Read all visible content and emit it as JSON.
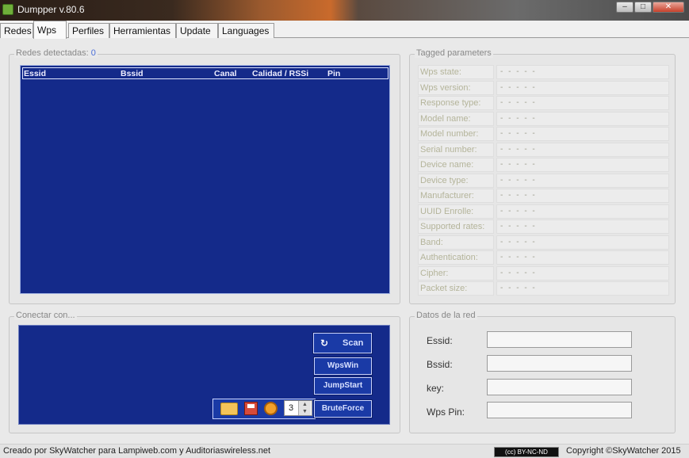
{
  "window": {
    "title": "Dumpper v.80.6",
    "minimize": "–",
    "maximize": "□",
    "close": "✕"
  },
  "tabs": [
    "Redes",
    "Wps",
    "Perfiles",
    "Herramientas",
    "Update",
    "Languages"
  ],
  "active_tab": "Wps",
  "networks": {
    "title": "Redes detectadas:",
    "count": "0",
    "columns": [
      "Essid",
      "Bssid",
      "Canal",
      "Calidad / RSSi",
      "Pin"
    ],
    "rows": []
  },
  "tagged": {
    "title": "Tagged parameters",
    "placeholder": "- - - - -",
    "labels": [
      "Wps state:",
      "Wps version:",
      "Response type:",
      "Model name:",
      "Model number:",
      "Serial number:",
      "Device name:",
      "Device type:",
      "Manufacturer:",
      "UUID Enrolle:",
      "Supported rates:",
      "Band:",
      "Authentication:",
      "Cipher:",
      "Packet size:"
    ]
  },
  "connect": {
    "title": "Conectar con...",
    "scan": "Scan",
    "wpswin": "WpsWin",
    "jumpstart": "JumpStart",
    "bruteforce": "BruteForce",
    "stepper_value": "3"
  },
  "datos": {
    "title": "Datos de la red",
    "fields": [
      {
        "label": "Essid:",
        "value": ""
      },
      {
        "label": "Bssid:",
        "value": ""
      },
      {
        "label": "key:",
        "value": ""
      },
      {
        "label": "Wps Pin:",
        "value": ""
      }
    ]
  },
  "status": {
    "left": "Creado por SkyWatcher para Lampiweb.com y Auditoriaswireless.net",
    "badge": "(cc) BY-NC-ND",
    "right": "Copyright ©SkyWatcher 2015"
  },
  "colors": {
    "panel_blue": "#142a8a",
    "label_olive": "#b4b49a"
  }
}
